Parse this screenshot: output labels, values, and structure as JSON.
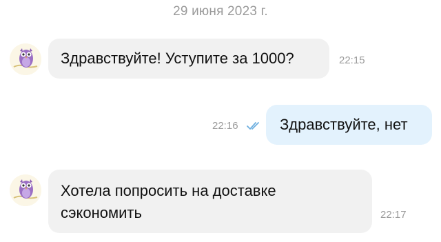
{
  "chat": {
    "date_separator": "29 июня 2023 г.",
    "messages": [
      {
        "direction": "incoming",
        "text": "Здравствуйте! Уступите за 1000?",
        "time": "22:15",
        "avatar_icon": "owl-avatar-icon"
      },
      {
        "direction": "outgoing",
        "text": "Здравствуйте, нет",
        "time": "22:16",
        "status_icon": "double-check-icon"
      },
      {
        "direction": "incoming",
        "text_line1": "Хотела попросить на доставке",
        "text_line2": "сэкономить",
        "time": "22:17",
        "avatar_icon": "owl-avatar-icon"
      }
    ]
  },
  "colors": {
    "incoming_bubble": "#f1f1f1",
    "outgoing_bubble": "#e3f2fd",
    "read_check": "#6fb0e0",
    "meta_text": "#9b9b9b"
  }
}
